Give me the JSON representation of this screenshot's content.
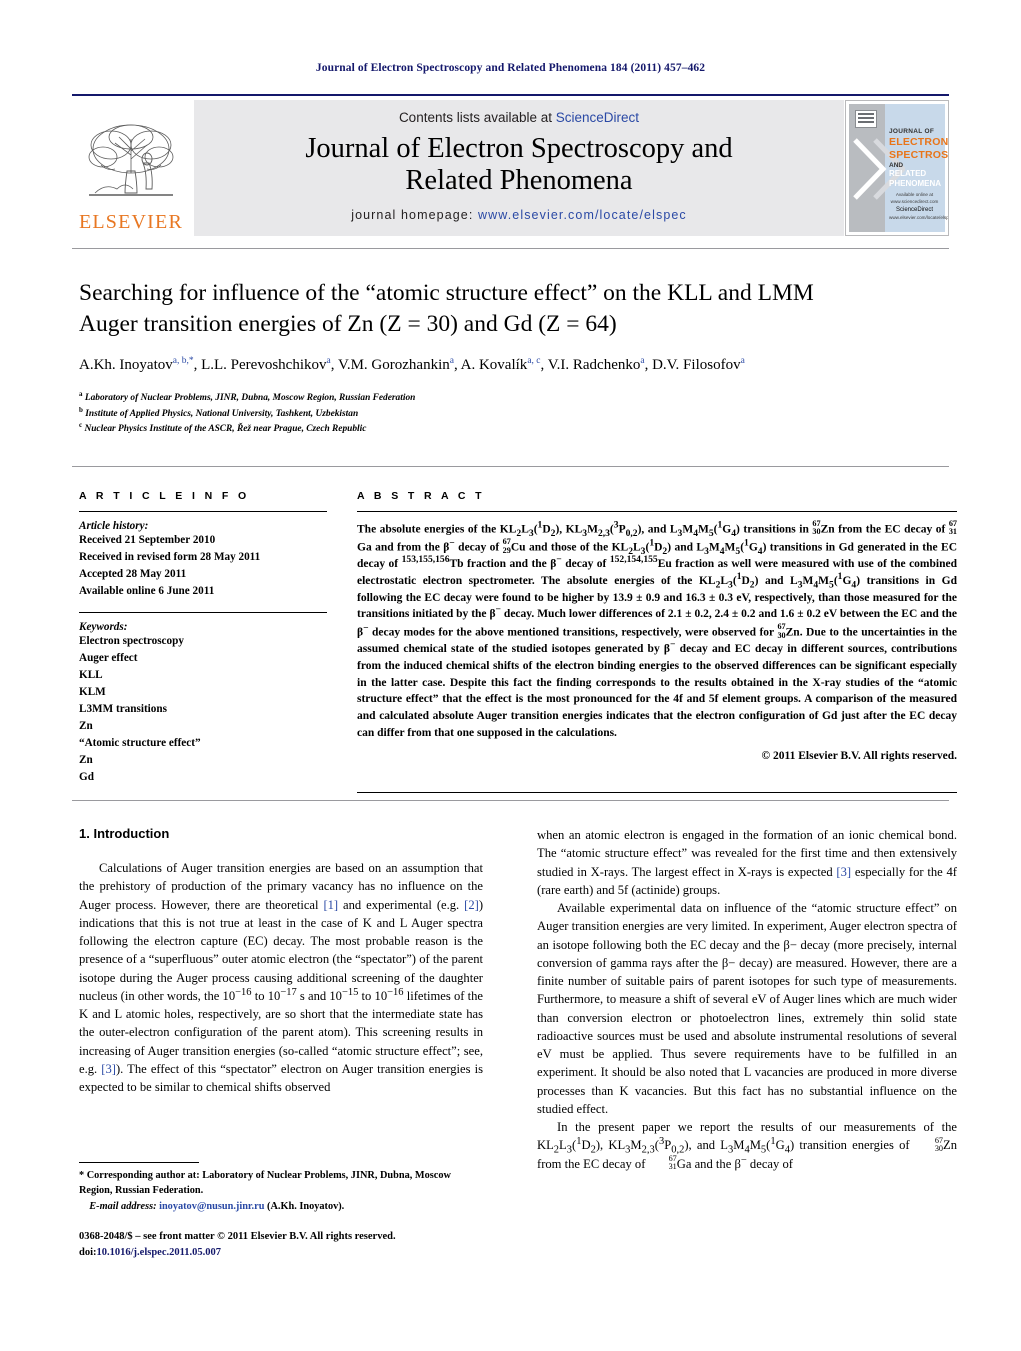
{
  "running_head": "Journal of Electron Spectroscopy and Related Phenomena 184 (2011) 457–462",
  "masthead": {
    "contents_prefix": "Contents lists available at ",
    "sciencedirect": "ScienceDirect",
    "journal_line1": "Journal of Electron Spectroscopy and",
    "journal_line2": "Related Phenomena",
    "homepage_label": "journal homepage:",
    "homepage_url": "www.elsevier.com/locate/elspec",
    "publisher_logo": "ELSEVIER",
    "cover": {
      "l1": "JOURNAL OF",
      "l2": "ELECTRON",
      "l3": "SPECTROSCOPY",
      "l4": "AND",
      "l5": "RELATED PHENOMENA",
      "foot_small": "Available online at www.sciencedirect.com",
      "foot_brand": "ScienceDirect",
      "foot_url": "www.elsevier.com/locate/elspec"
    }
  },
  "article": {
    "title_line1": "Searching for influence of the “atomic structure effect” on the KLL and LMM",
    "title_line2": "Auger transition energies of Zn (Z = 30) and Gd (Z = 64)",
    "authors": [
      {
        "name": "A.Kh. Inoyatov",
        "marks": "a, b,",
        "star": "*"
      },
      {
        "name": "L.L. Perevoshchikov",
        "marks": "a"
      },
      {
        "name": "V.M. Gorozhankin",
        "marks": "a"
      },
      {
        "name": "A. Kovalík",
        "marks": "a, c"
      },
      {
        "name": "V.I. Radchenko",
        "marks": "a"
      },
      {
        "name": "D.V. Filosofov",
        "marks": "a"
      }
    ],
    "affiliations": [
      {
        "mark": "a",
        "text": "Laboratory of Nuclear Problems, JINR, Dubna, Moscow Region, Russian Federation"
      },
      {
        "mark": "b",
        "text": "Institute of Applied Physics, National University, Tashkent, Uzbekistan"
      },
      {
        "mark": "c",
        "text": "Nuclear Physics Institute of the ASCR, Řež near Prague, Czech Republic"
      }
    ]
  },
  "info": {
    "heading": "A R T I C L E   I N F O",
    "history_label": "Article history:",
    "history": [
      "Received 21 September 2010",
      "Received in revised form 28 May 2011",
      "Accepted 28 May 2011",
      "Available online 6 June 2011"
    ],
    "keywords_label": "Keywords:",
    "keywords": [
      "Electron spectroscopy",
      "Auger effect",
      "KLL",
      "KLM",
      "L3MM transitions",
      "Zn",
      "“Atomic structure effect”",
      "Zn",
      "Gd"
    ]
  },
  "abstract": {
    "heading": "A B S T R A C T",
    "copyright": "© 2011 Elsevier B.V. All rights reserved."
  },
  "body": {
    "intro_heading": "1.  Introduction",
    "left_p1_a": "Calculations of Auger transition energies are based on an assumption that the prehistory of production of the primary vacancy has no influence on the Auger process. However, there are theoretical ",
    "ref1": "[1]",
    "left_p1_b": " and experimental (e.g. ",
    "ref2": "[2]",
    "left_p1_c": ") indications that this is not true at least in the case of K and L Auger spectra following the electron capture (EC) decay. The most probable reason is the presence of a “superfluous” outer atomic electron (the “spectator”) of the parent isotope during the Auger process causing additional screening of the daughter nucleus (in other words, the 10",
    "exp16": "−16",
    "left_p1_d": " to 10",
    "exp17": "−17",
    "left_p1_e": " s and 10",
    "exp15": "−15",
    "left_p1_f": " to 10",
    "exp16b": "−16",
    "left_p1_g": " lifetimes of the K and L atomic holes, respectively, are so short that the intermediate state has the outer-electron configuration of the parent atom). This screening results in increasing of Auger transition energies (so-called “atomic structure effect”; see, e.g. ",
    "ref3": "[3]",
    "left_p1_h": "). The effect of this “spectator” electron on Auger transition energies is expected to be similar to chemical shifts observed",
    "right_p1_a": "when an atomic electron is engaged in the formation of an ionic chemical bond. The “atomic structure effect” was revealed for the first time and then extensively studied in X-rays. The largest effect in X-rays is expected ",
    "ref3b": "[3]",
    "right_p1_b": " especially for the 4f (rare earth) and 5f (actinide) groups.",
    "right_p2": "Available experimental data on influence of the “atomic structure effect” on Auger transition energies are very limited. In experiment, Auger electron spectra of an isotope following both the EC decay and the β− decay (more precisely, internal conversion of gamma rays after the β− decay) are measured. However, there are a finite number of suitable pairs of parent isotopes for such type of measurements. Furthermore, to measure a shift of several eV of Auger lines which are much wider than conversion electron or photoelectron lines, extremely thin solid state radioactive sources must be used and absolute instrumental resolutions of several eV must be applied. Thus severe requirements have to be fulfilled in an experiment. It should be also noted that L vacancies are produced in more diverse processes than K vacancies. But this fact has no substantial influence on the studied effect."
  },
  "footnotes": {
    "corresponding": "* Corresponding author at: Laboratory of Nuclear Problems, JINR, Dubna, Moscow Region, Russian Federation.",
    "email_label": "E-mail address:",
    "email": "inoyatov@nusun.jinr.ru",
    "email_owner": "(A.Kh. Inoyatov).",
    "issn_line": "0368-2048/$ – see front matter © 2011 Elsevier B.V. All rights reserved.",
    "doi_label": "doi:",
    "doi": "10.1016/j.elspec.2011.05.007"
  }
}
